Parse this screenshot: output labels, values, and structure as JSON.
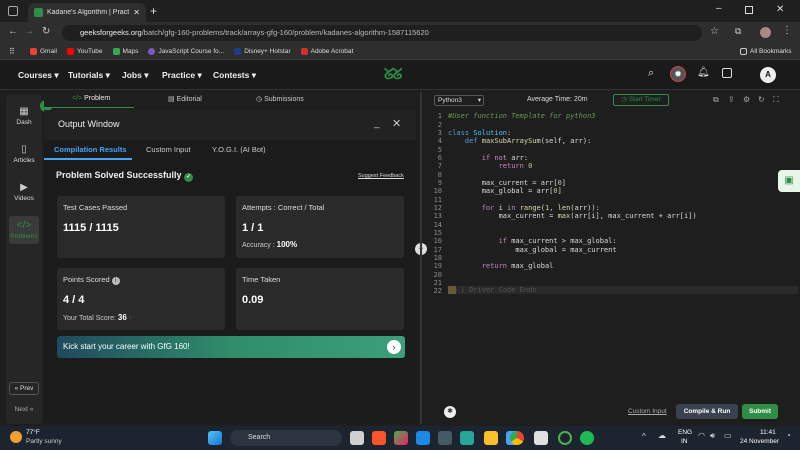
{
  "browser": {
    "tab_title": "Kadane's Algorithm | Practice | G",
    "url_domain": "geeksforgeeks.org",
    "url_path": "/batch/gfg-160-problems/track/arrays-gfg-160/problem/kadanes-algorithm-1587115620",
    "bookmarks": [
      "Gmail",
      "YouTube",
      "Maps",
      "JavaScript Course fo...",
      "Disney+ Hotstar",
      "Adobe Acrobat"
    ],
    "all_bookmarks": "All Bookmarks"
  },
  "nav": {
    "items": [
      "Courses",
      "Tutorials",
      "Jobs",
      "Practice",
      "Contests"
    ],
    "avatar": "A"
  },
  "rail": {
    "items": [
      "Dash",
      "Articles",
      "Videos",
      "Problems"
    ],
    "prev": "Prev",
    "next": "Next"
  },
  "problem_tabs": [
    "Problem",
    "Editorial",
    "Submissions"
  ],
  "output": {
    "title": "Output Window",
    "tabs": [
      "Compilation Results",
      "Custom Input",
      "Y.O.G.I. (AI Bot)"
    ],
    "status": "Problem Solved Successfully",
    "feedback": "Suggest Feedback",
    "test_cases_label": "Test Cases Passed",
    "test_cases_value": "1115 / 1115",
    "attempts_label": "Attempts : Correct / Total",
    "attempts_value": "1 / 1",
    "accuracy_label": "Accuracy :",
    "accuracy_value": "100%",
    "points_label": "Points Scored",
    "points_value": "4 / 4",
    "total_score_label": "Your Total Score:",
    "total_score_value": "36",
    "time_label": "Time Taken",
    "time_value": "0.09",
    "banner": "Kick start your career with GfG 160!"
  },
  "editor": {
    "language": "Python3",
    "avg_time": "Average Time: 20m",
    "start_timer": "Start Timer",
    "custom_input": "Custom Input",
    "compile_run": "Compile & Run",
    "submit": "Submit",
    "driver_code": "} Driver Code Ends"
  },
  "taskbar": {
    "weather_temp": "77°F",
    "weather_desc": "Partly sunny",
    "search": "Search",
    "lang1": "ENG",
    "lang2": "IN",
    "time": "11:41",
    "date": "24 November"
  }
}
